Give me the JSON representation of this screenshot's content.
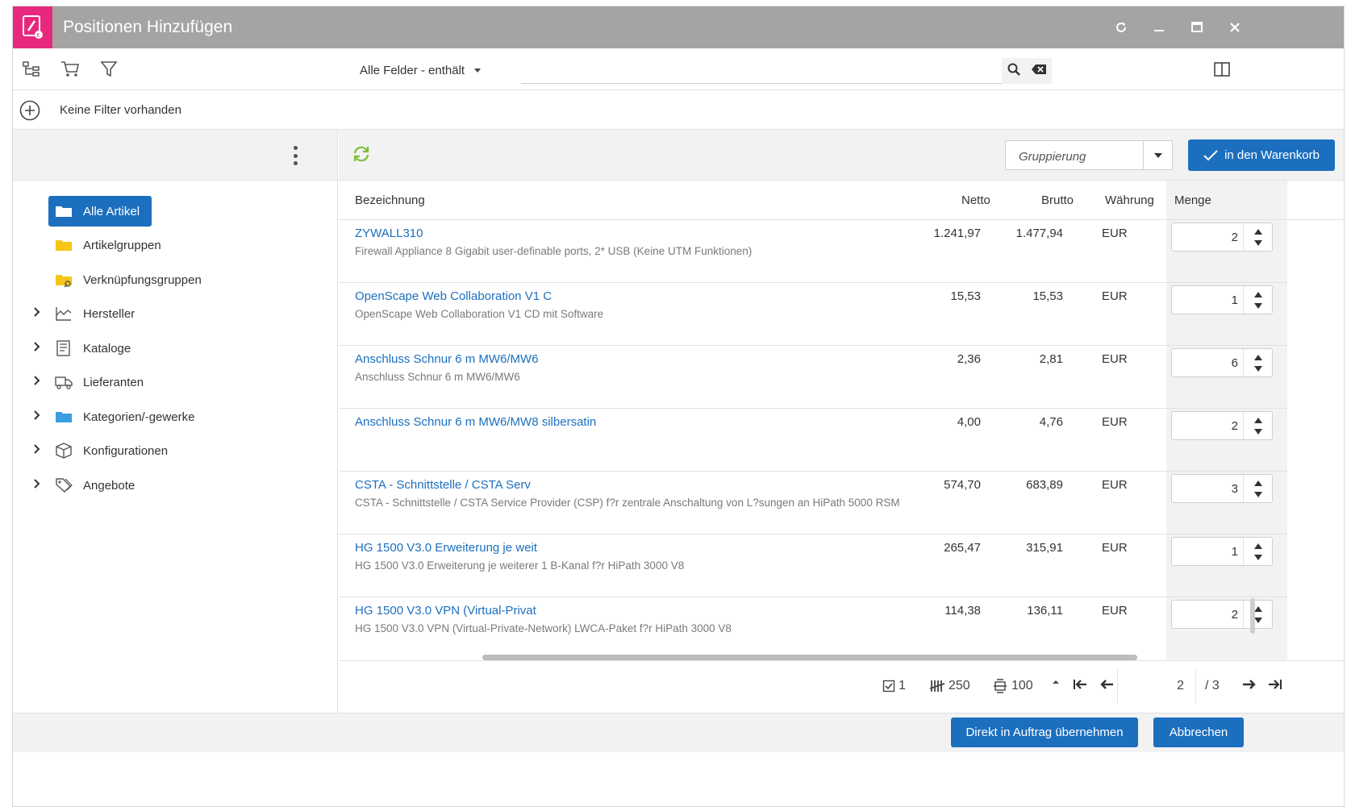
{
  "window": {
    "title": "Positionen Hinzufügen",
    "controls": [
      "refresh-icon",
      "minimize-icon",
      "maximize-icon",
      "close-icon"
    ]
  },
  "colors": {
    "accent": "#1c6fbf",
    "brand": "#e8287d",
    "titlebar": "#a4a4a4",
    "refresh": "#7cbf3a"
  },
  "toolbar": {
    "field_select": "Alle Felder - enthält",
    "search_value": ""
  },
  "filter": {
    "text": "Keine Filter vorhanden"
  },
  "tree": {
    "items": [
      {
        "label": "Alle Artikel",
        "icon": "folder-icon",
        "selected": true
      },
      {
        "label": "Artikelgruppen",
        "icon": "folder-icon"
      },
      {
        "label": "Verknüpfungsgruppen",
        "icon": "folder-link-icon"
      },
      {
        "label": "Hersteller",
        "icon": "factory-icon",
        "expandable": true
      },
      {
        "label": "Kataloge",
        "icon": "catalog-icon",
        "expandable": true
      },
      {
        "label": "Lieferanten",
        "icon": "truck-icon",
        "expandable": true
      },
      {
        "label": "Kategorien/-gewerke",
        "icon": "folder-icon",
        "expandable": true
      },
      {
        "label": "Konfigurationen",
        "icon": "box-icon",
        "expandable": true
      },
      {
        "label": "Angebote",
        "icon": "tags-icon",
        "expandable": true
      }
    ]
  },
  "grid": {
    "grouping_placeholder": "Gruppierung",
    "cart_button": "in den Warenkorb",
    "columns": {
      "bezeichnung": "Bezeichnung",
      "netto": "Netto",
      "brutto": "Brutto",
      "waehrung": "Währung",
      "menge": "Menge"
    },
    "rows": [
      {
        "name": "ZYWALL310",
        "desc": "Firewall Appliance 8 Gigabit user-definable ports, 2* USB (Keine UTM Funktionen)",
        "netto": "1.241,97",
        "brutto": "1.477,94",
        "currency": "EUR",
        "qty": "2"
      },
      {
        "name": "OpenScape Web Collaboration V1 C",
        "desc": "OpenScape Web Collaboration V1 CD mit Software",
        "netto": "15,53",
        "brutto": "15,53",
        "currency": "EUR",
        "qty": "1"
      },
      {
        "name": "Anschluss Schnur 6 m MW6/MW6",
        "desc": "Anschluss Schnur 6 m MW6/MW6",
        "netto": "2,36",
        "brutto": "2,81",
        "currency": "EUR",
        "qty": "6"
      },
      {
        "name": "Anschluss Schnur 6 m MW6/MW8 silbersatin",
        "desc": "",
        "netto": "4,00",
        "brutto": "4,76",
        "currency": "EUR",
        "qty": "2"
      },
      {
        "name": "CSTA - Schnittstelle / CSTA Serv",
        "desc": "CSTA - Schnittstelle / CSTA Service Provider (CSP) f?r zentrale Anschaltung von L?sungen an HiPath 5000 RSM",
        "netto": "574,70",
        "brutto": "683,89",
        "currency": "EUR",
        "qty": "3"
      },
      {
        "name": "HG 1500 V3.0 Erweiterung je weit",
        "desc": "HG 1500 V3.0 Erweiterung je weiterer 1 B-Kanal f?r HiPath 3000 V8",
        "netto": "265,47",
        "brutto": "315,91",
        "currency": "EUR",
        "qty": "1"
      },
      {
        "name": "HG 1500 V3.0 VPN (Virtual-Privat",
        "desc": "HG 1500 V3.0 VPN (Virtual-Private-Network) LWCA-Paket f?r HiPath 3000 V8",
        "netto": "114,38",
        "brutto": "136,11",
        "currency": "EUR",
        "qty": "2"
      }
    ]
  },
  "pager": {
    "selected_count": "1",
    "total_count": "250",
    "page_size": "100",
    "current_page": "2",
    "total_pages": "/ 3"
  },
  "footer": {
    "primary_button": "Direkt in Auftrag übernehmen",
    "cancel_button": "Abbrechen"
  }
}
